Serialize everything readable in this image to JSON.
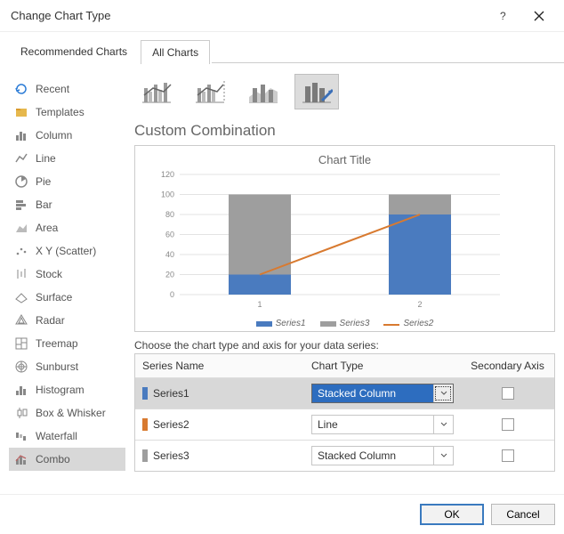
{
  "window": {
    "title": "Change Chart Type"
  },
  "tabs": {
    "recommended": "Recommended Charts",
    "all": "All Charts"
  },
  "sidebar": [
    {
      "icon": "recent",
      "label": "Recent"
    },
    {
      "icon": "templates",
      "label": "Templates"
    },
    {
      "icon": "column",
      "label": "Column"
    },
    {
      "icon": "line",
      "label": "Line"
    },
    {
      "icon": "pie",
      "label": "Pie"
    },
    {
      "icon": "bar",
      "label": "Bar"
    },
    {
      "icon": "area",
      "label": "Area"
    },
    {
      "icon": "xy",
      "label": "X Y (Scatter)"
    },
    {
      "icon": "stock",
      "label": "Stock"
    },
    {
      "icon": "surface",
      "label": "Surface"
    },
    {
      "icon": "radar",
      "label": "Radar"
    },
    {
      "icon": "treemap",
      "label": "Treemap"
    },
    {
      "icon": "sunburst",
      "label": "Sunburst"
    },
    {
      "icon": "histogram",
      "label": "Histogram"
    },
    {
      "icon": "box",
      "label": "Box & Whisker"
    },
    {
      "icon": "waterfall",
      "label": "Waterfall"
    },
    {
      "icon": "combo",
      "label": "Combo",
      "selected": true
    }
  ],
  "main": {
    "heading": "Custom Combination",
    "chart_title": "Chart Title",
    "instruction": "Choose the chart type and axis for your data series:",
    "headers": {
      "name": "Series Name",
      "type": "Chart Type",
      "axis": "Secondary Axis"
    },
    "rows": [
      {
        "name": "Series1",
        "color": "#4a7bbf",
        "type": "Stacked Column",
        "highlight": true
      },
      {
        "name": "Series2",
        "color": "#d87a30",
        "type": "Line"
      },
      {
        "name": "Series3",
        "color": "#9e9e9e",
        "type": "Stacked Column"
      }
    ]
  },
  "footer": {
    "ok": "OK",
    "cancel": "Cancel"
  },
  "chart_data": {
    "type": "combo",
    "categories": [
      "1",
      "2"
    ],
    "series": [
      {
        "name": "Series1",
        "type": "stacked-column",
        "color": "#4a7bbf",
        "values": [
          20,
          80
        ]
      },
      {
        "name": "Series3",
        "type": "stacked-column",
        "color": "#9e9e9e",
        "values": [
          80,
          20
        ]
      },
      {
        "name": "Series2",
        "type": "line",
        "color": "#d87a30",
        "values": [
          20,
          80
        ]
      }
    ],
    "title": "Chart Title",
    "ylim": [
      0,
      120
    ],
    "yticks": [
      0,
      20,
      40,
      60,
      80,
      100,
      120
    ],
    "legend": [
      "Series1",
      "Series3",
      "Series2"
    ]
  }
}
